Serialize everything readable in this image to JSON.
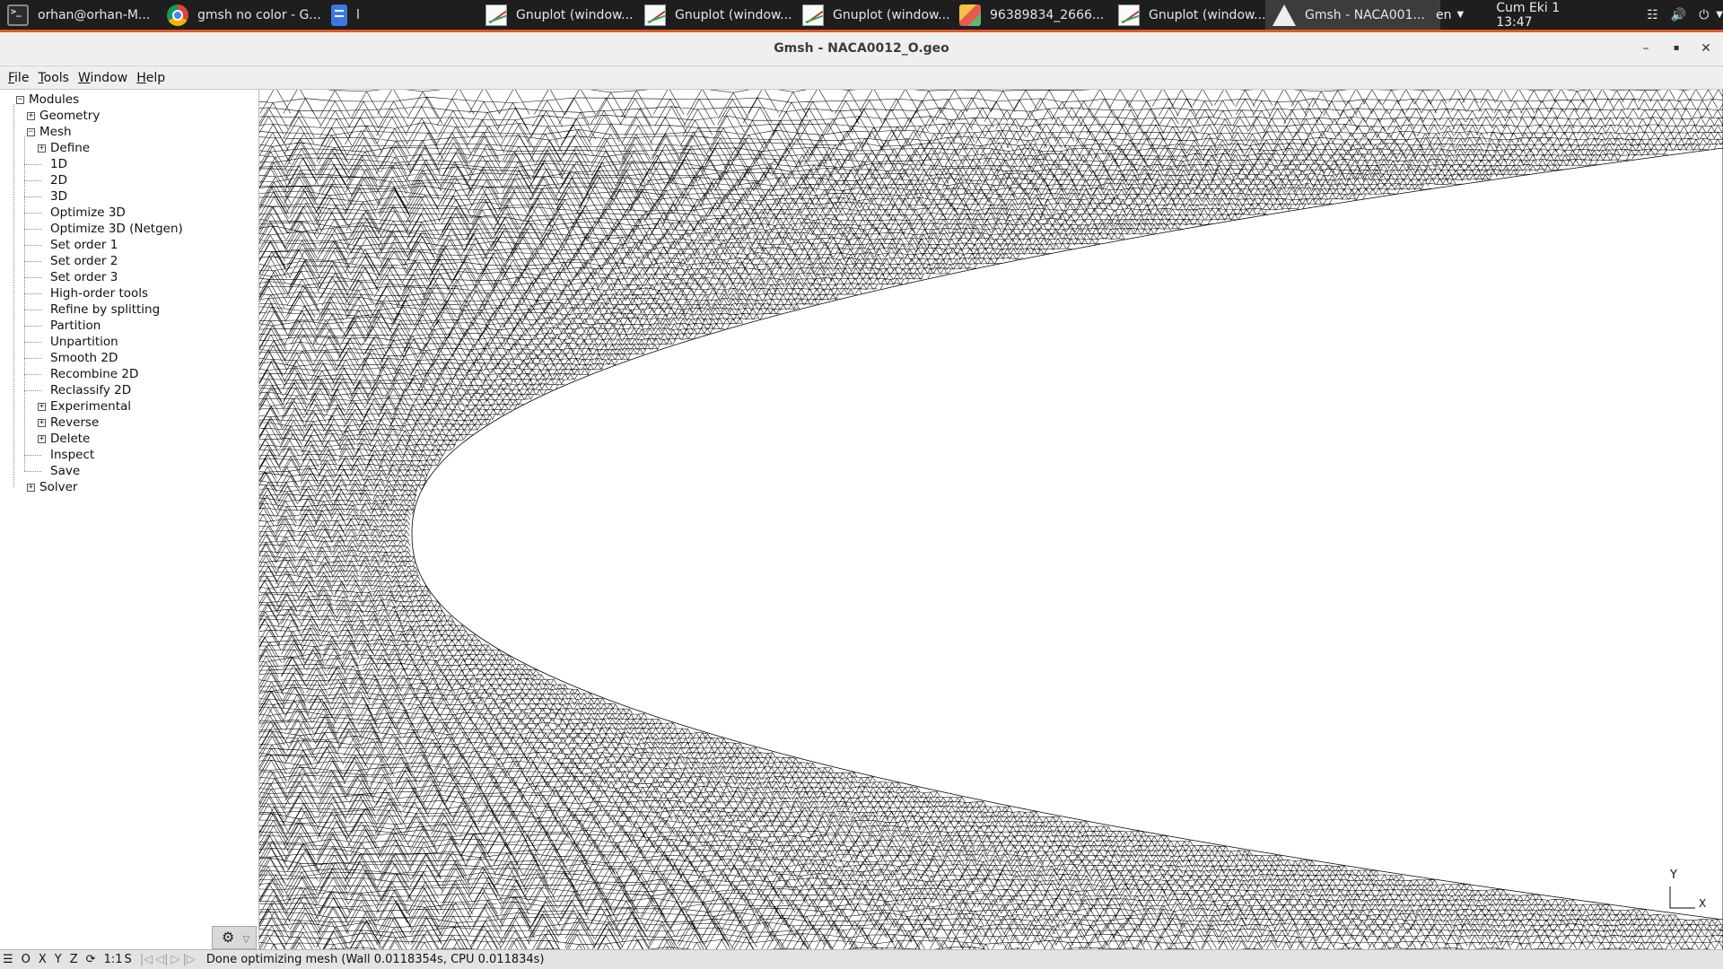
{
  "taskbar": {
    "items": [
      {
        "label": "orhan@orhan-M...",
        "icon": "terminal-icon"
      },
      {
        "label": "gmsh no color - G...",
        "icon": "chrome-icon"
      },
      {
        "label": "l",
        "icon": "document-icon"
      },
      {
        "label": "Gnuplot (window...",
        "icon": "gnuplot-icon"
      },
      {
        "label": "Gnuplot (window...",
        "icon": "gnuplot-icon"
      },
      {
        "label": "Gnuplot (window...",
        "icon": "gnuplot-icon"
      },
      {
        "label": "96389834_2666...",
        "icon": "image-viewer-icon"
      },
      {
        "label": "Gnuplot (window...",
        "icon": "gnuplot-icon"
      },
      {
        "label": "Gmsh - NACA001...",
        "icon": "gmsh-icon"
      }
    ],
    "active_index": 8,
    "language": "en",
    "clock": "Cum Eki 1  13:47"
  },
  "window": {
    "title": "Gmsh - NACA0012_O.geo",
    "minimize": "–",
    "maximize": "▪",
    "close": "✕"
  },
  "menu": [
    "File",
    "Tools",
    "Window",
    "Help"
  ],
  "tree": {
    "root": "Modules",
    "geometry": "Geometry",
    "mesh": "Mesh",
    "mesh_items": [
      {
        "label": "Define",
        "expandable": true
      },
      {
        "label": "1D",
        "expandable": false
      },
      {
        "label": "2D",
        "expandable": false
      },
      {
        "label": "3D",
        "expandable": false
      },
      {
        "label": "Optimize 3D",
        "expandable": false
      },
      {
        "label": "Optimize 3D (Netgen)",
        "expandable": false
      },
      {
        "label": "Set order 1",
        "expandable": false
      },
      {
        "label": "Set order 2",
        "expandable": false
      },
      {
        "label": "Set order 3",
        "expandable": false
      },
      {
        "label": "High-order tools",
        "expandable": false
      },
      {
        "label": "Refine by splitting",
        "expandable": false
      },
      {
        "label": "Partition",
        "expandable": false
      },
      {
        "label": "Unpartition",
        "expandable": false
      },
      {
        "label": "Smooth 2D",
        "expandable": false
      },
      {
        "label": "Recombine 2D",
        "expandable": false
      },
      {
        "label": "Reclassify 2D",
        "expandable": false
      },
      {
        "label": "Experimental",
        "expandable": true
      },
      {
        "label": "Reverse",
        "expandable": true
      },
      {
        "label": "Delete",
        "expandable": true
      },
      {
        "label": "Inspect",
        "expandable": false
      },
      {
        "label": "Save",
        "expandable": false
      }
    ],
    "solver": "Solver"
  },
  "viewport": {
    "axis_y": "Y",
    "axis_x": "X"
  },
  "statusbar": {
    "buttons": [
      "O",
      "X",
      "Y",
      "Z",
      "1:1",
      "S"
    ],
    "message": "Done optimizing mesh (Wall 0.0118354s, CPU 0.011834s)"
  },
  "colors": {
    "taskbar_bg": "#1e1e1e",
    "taskbar_accent": "#e0582a",
    "mesh_line": "#000000",
    "viewport_bg": "#ffffff"
  }
}
